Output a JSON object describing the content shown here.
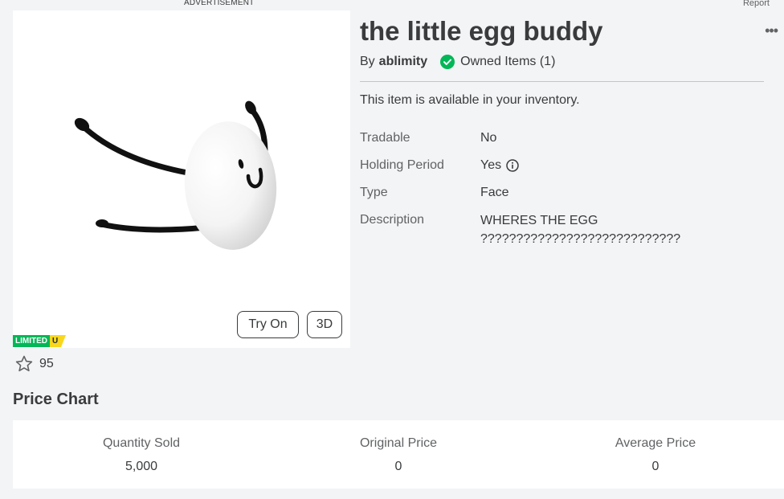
{
  "ad": {
    "label": "ADVERTISEMENT"
  },
  "report": {
    "label": "Report"
  },
  "item": {
    "title": "the little egg buddy",
    "by_prefix": "By",
    "creator": "ablimity",
    "owned_text": "Owned Items (1)",
    "availability": "This item is available in your inventory.",
    "more_menu_glyph": "•••"
  },
  "thumbnail": {
    "try_on_label": "Try On",
    "three_d_label": "3D",
    "badge_limited": "LIMITED",
    "badge_u": "U",
    "favorites": "95"
  },
  "details": [
    {
      "label": "Tradable",
      "value": "No"
    },
    {
      "label": "Holding Period",
      "value": "Yes"
    },
    {
      "label": "Type",
      "value": "Face"
    },
    {
      "label": "Description",
      "value": "WHERES THE EGG ????????????????????????????"
    }
  ],
  "price_chart": {
    "title": "Price Chart",
    "stats": [
      {
        "label": "Quantity Sold",
        "value": "5,000"
      },
      {
        "label": "Original Price",
        "value": "0"
      },
      {
        "label": "Average Price",
        "value": "0"
      }
    ]
  },
  "colors": {
    "page_bg": "#f2f4f5",
    "text": "#393b3d",
    "muted": "#606264",
    "owned_check": "#02b757",
    "limited_green": "#02b757",
    "limited_yellow": "#f9d71c"
  },
  "icons": [
    "favorite-star-icon",
    "owned-check-icon",
    "info-icon",
    "more-options-icon"
  ]
}
